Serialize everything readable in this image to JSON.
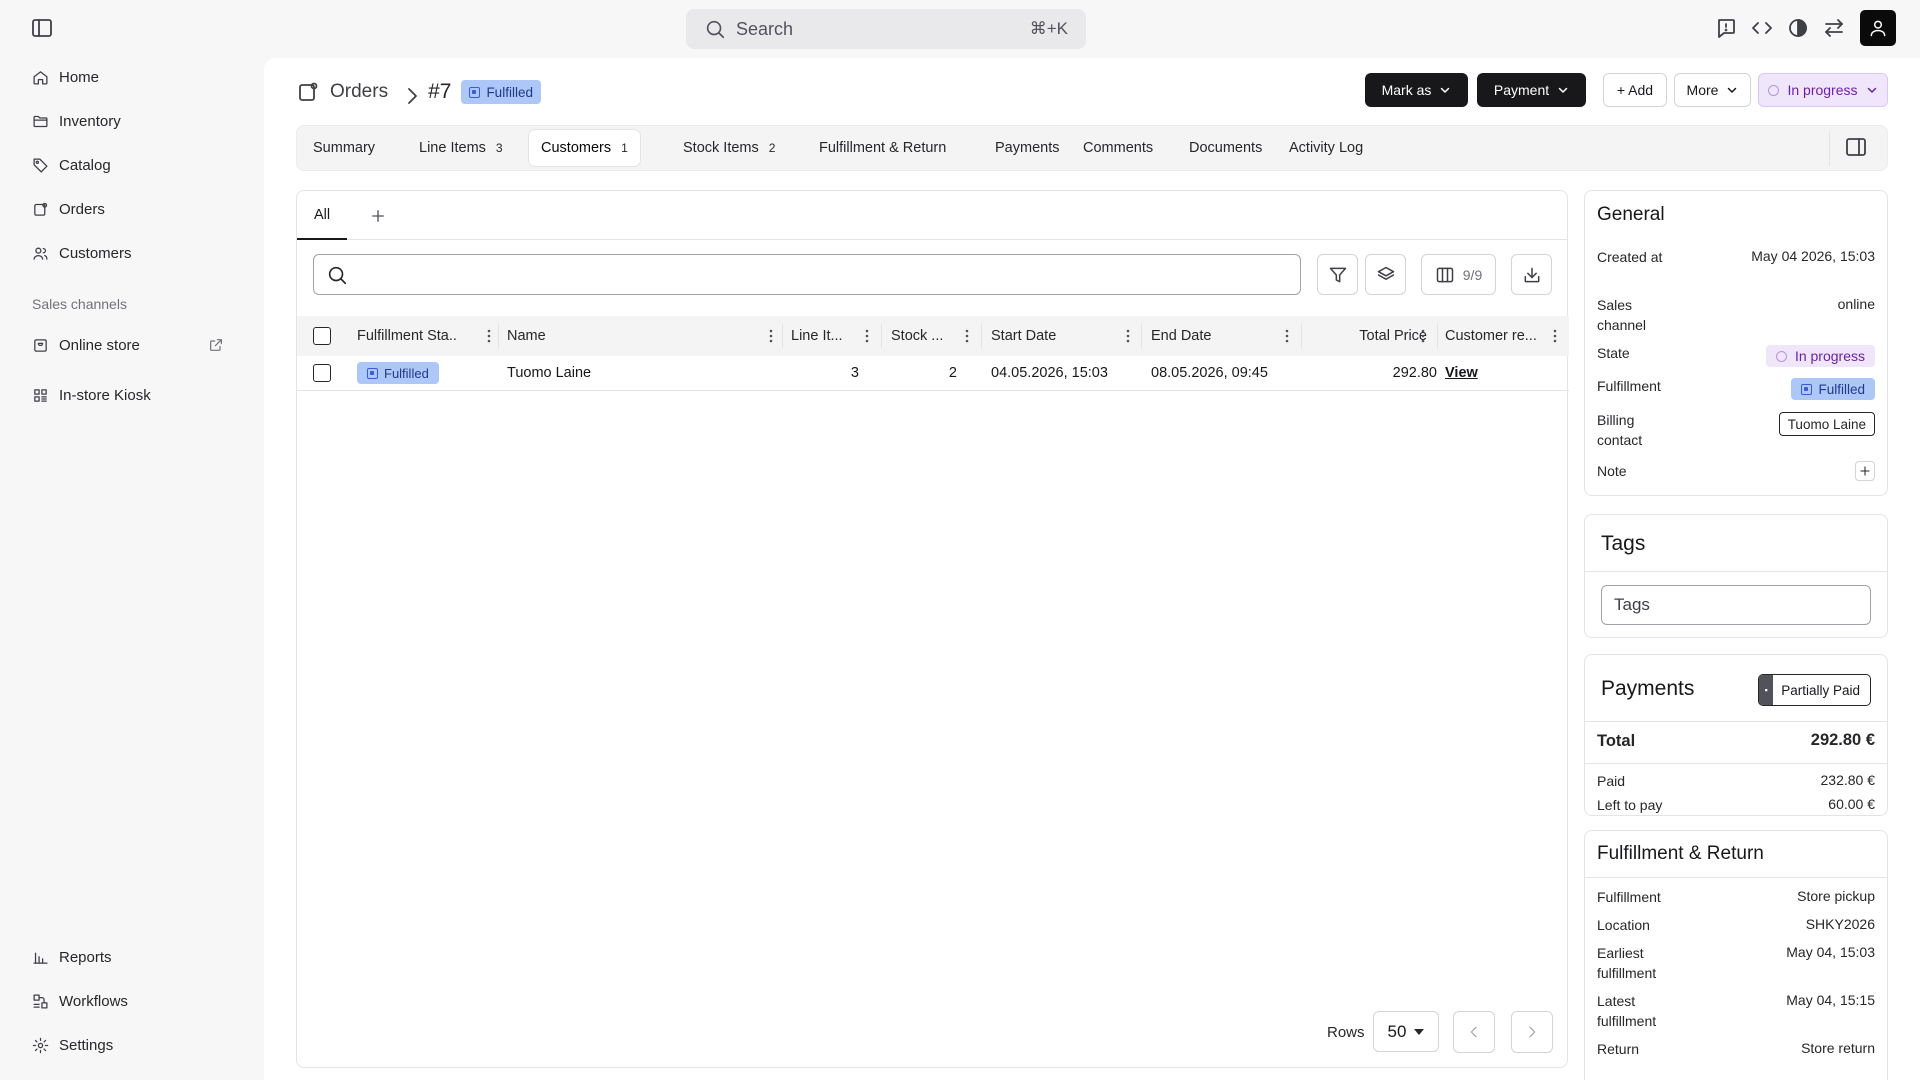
{
  "topbar": {
    "search_label": "Search",
    "search_shortcut": "⌘+K",
    "icons": [
      "sidebar-toggle-icon",
      "feedback-icon",
      "code-icon",
      "theme-icon",
      "switch-icon",
      "user-icon"
    ]
  },
  "sidebar": {
    "items": [
      {
        "label": "Home",
        "icon": "home-icon"
      },
      {
        "label": "Inventory",
        "icon": "folder-icon"
      },
      {
        "label": "Catalog",
        "icon": "tag-icon"
      },
      {
        "label": "Orders",
        "icon": "orders-icon"
      },
      {
        "label": "Customers",
        "icon": "users-icon"
      }
    ],
    "section_label": "Sales channels",
    "channels": [
      {
        "label": "Online store",
        "icon": "store-icon"
      },
      {
        "label": "In-store Kiosk",
        "icon": "kiosk-icon"
      }
    ],
    "bottom": [
      {
        "label": "Reports",
        "icon": "chart-icon"
      },
      {
        "label": "Workflows",
        "icon": "workflow-icon"
      },
      {
        "label": "Settings",
        "icon": "gear-icon"
      }
    ]
  },
  "header": {
    "breadcrumb_root": "Orders",
    "order_number": "#7",
    "status_badge": "Fulfilled",
    "mark_as_label": "Mark as",
    "payment_label": "Payment",
    "add_label": "+ Add",
    "more_label": "More",
    "state_label": "In progress"
  },
  "tabs": [
    {
      "label": "Summary",
      "count": ""
    },
    {
      "label": "Line Items",
      "count": "3"
    },
    {
      "label": "Customers",
      "count": "1"
    },
    {
      "label": "Stock Items",
      "count": "2"
    },
    {
      "label": "Fulfillment & Return",
      "count": ""
    },
    {
      "label": "Payments",
      "count": ""
    },
    {
      "label": "Comments",
      "count": ""
    },
    {
      "label": "Documents",
      "count": ""
    },
    {
      "label": "Activity Log",
      "count": ""
    }
  ],
  "table": {
    "view_tab": "All",
    "search_placeholder": "",
    "columns_count": "9/9",
    "columns": [
      "Fulfillment Sta...",
      "Name",
      "Line It...",
      "Stock ...",
      "Start Date",
      "End Date",
      "Total Price",
      "Customer re..."
    ],
    "rows": [
      {
        "fulfillment": "Fulfilled",
        "name": "Tuomo Laine",
        "line_items": "3",
        "stock": "2",
        "start_date": "04.05.2026, 15:03",
        "end_date": "08.05.2026, 09:45",
        "total_price": "292.80",
        "customer_ref": "View"
      }
    ],
    "rows_label": "Rows",
    "rows_value": "50"
  },
  "general": {
    "title": "General",
    "created_label": "Created at",
    "created_value": "May 04 2026, 15:03",
    "channel_label": "Sales channel",
    "channel_value": "online",
    "state_label": "State",
    "state_value": "In progress",
    "fulfillment_label": "Fulfillment",
    "fulfillment_value": "Fulfilled",
    "billing_label": "Billing contact",
    "billing_value": "Tuomo Laine",
    "note_label": "Note"
  },
  "tags": {
    "title": "Tags",
    "placeholder": "Tags"
  },
  "payments": {
    "title": "Payments",
    "status": "Partially Paid",
    "total_label": "Total",
    "total_value": "292.80 €",
    "paid_label": "Paid",
    "paid_value": "232.80 €",
    "left_label": "Left to pay",
    "left_value": "60.00 €"
  },
  "fulfillment_return": {
    "title": "Fulfillment & Return",
    "fulfillment_label": "Fulfillment",
    "fulfillment_value": "Store pickup",
    "location_label": "Location",
    "location_value": "SHKY2026",
    "earliest_label": "Earliest fulfillment",
    "earliest_value": "May 04, 15:03",
    "latest_label": "Latest fulfillment",
    "latest_value": "May 04, 15:15",
    "return_label": "Return",
    "return_value": "Store return"
  }
}
